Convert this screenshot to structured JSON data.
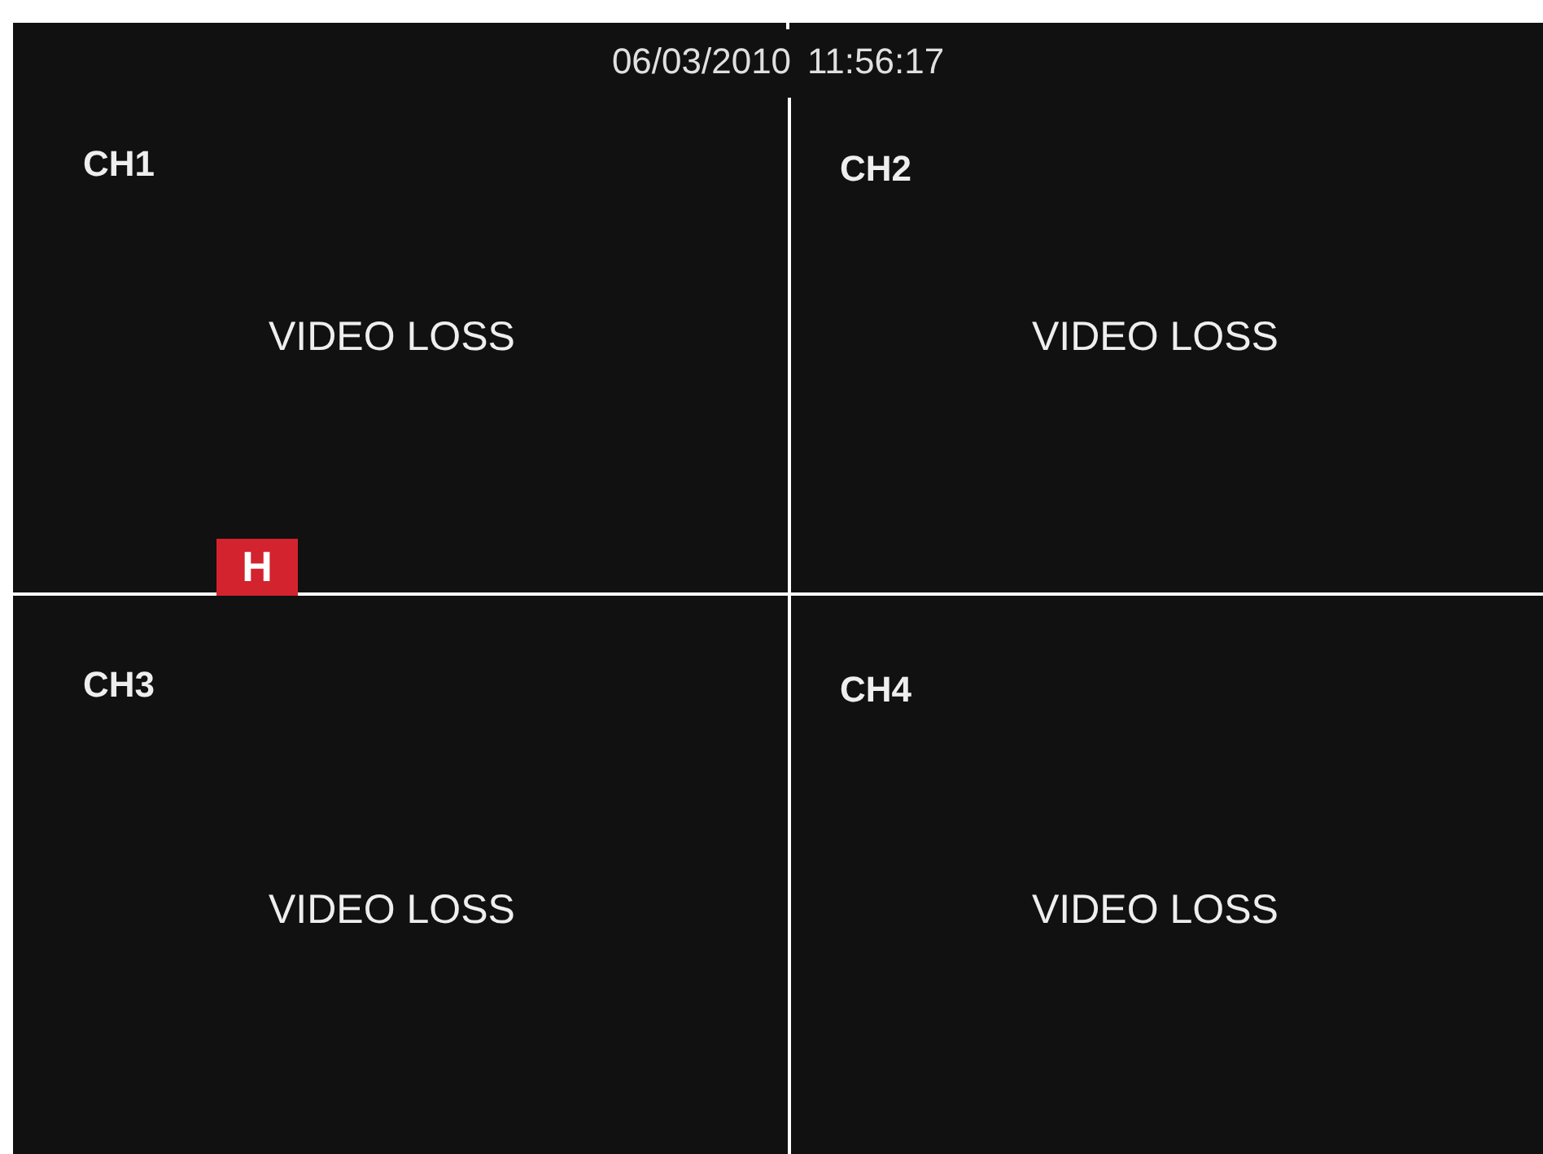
{
  "date": "06/03/2010",
  "time": "11:56:17",
  "channels": [
    {
      "label": "CH1",
      "status": "VIDEO LOSS"
    },
    {
      "label": "CH2",
      "status": "VIDEO LOSS"
    },
    {
      "label": "CH3",
      "status": "VIDEO LOSS"
    },
    {
      "label": "CH4",
      "status": "VIDEO LOSS"
    }
  ],
  "badge": "H"
}
